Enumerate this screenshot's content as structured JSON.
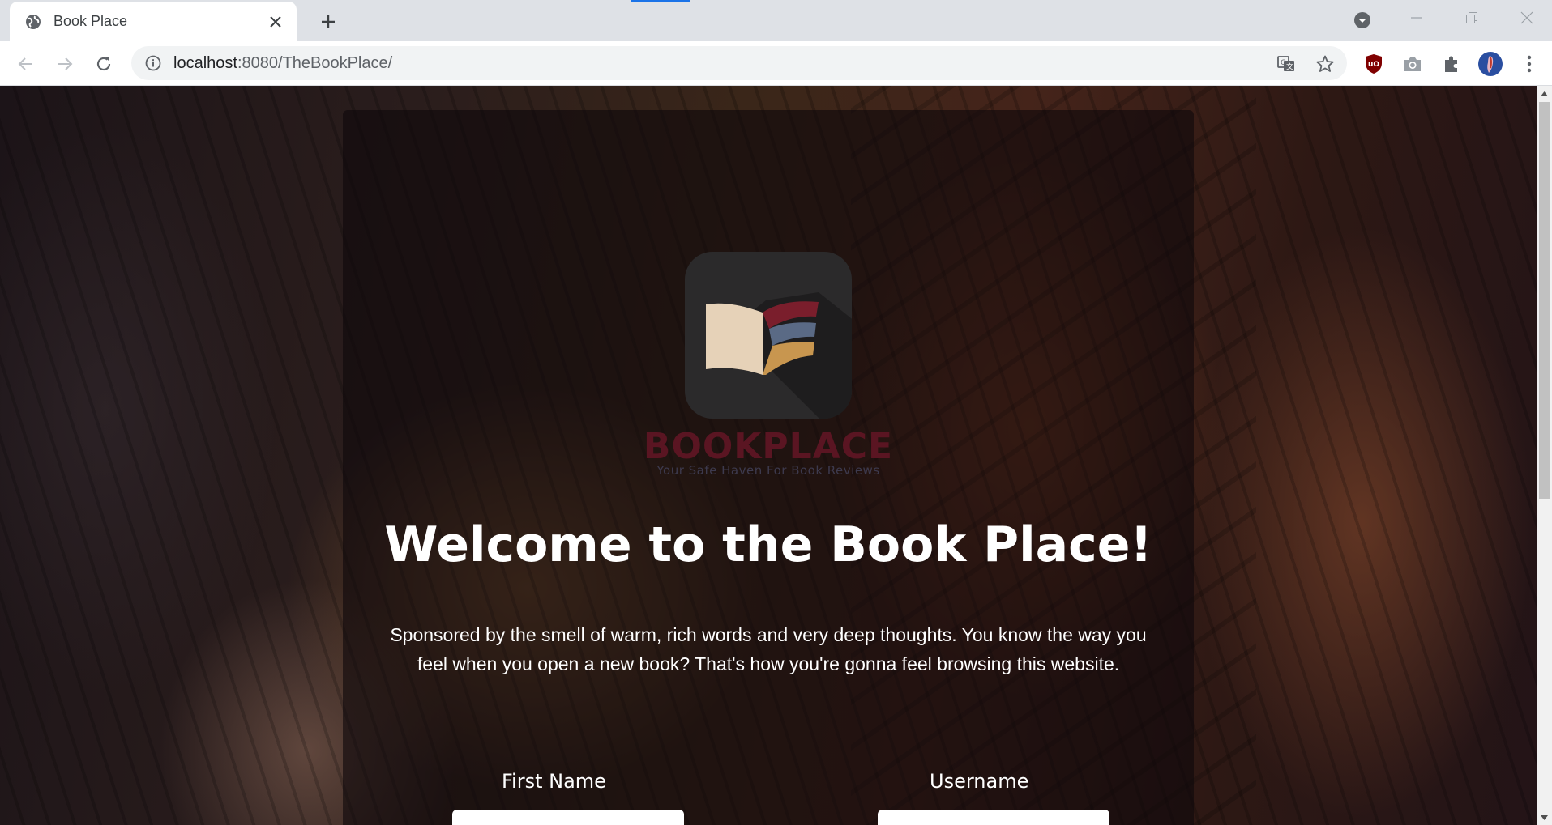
{
  "browser": {
    "tab": {
      "title": "Book Place",
      "favicon": "globe-icon",
      "close_icon": "close-icon"
    },
    "new_tab_icon": "plus-icon",
    "tab_search_icon": "chevron-down-icon",
    "window_controls": [
      "minimize-icon",
      "restore-icon",
      "close-icon"
    ],
    "nav": {
      "back": "arrow-left-icon",
      "forward": "arrow-right-icon",
      "reload": "reload-icon"
    },
    "omnibox": {
      "info_icon": "info-icon",
      "url_host": "localhost",
      "url_rest": ":8080/TheBookPlace/",
      "translate_icon": "translate-icon",
      "bookmark_icon": "star-icon"
    },
    "extensions": [
      "ublock-icon",
      "camera-icon",
      "puzzle-icon",
      "profile-avatar",
      "kebab-menu-icon"
    ],
    "colors": {
      "accent": "#1a73e8",
      "tabstrip": "#dee1e6"
    }
  },
  "page": {
    "logo": {
      "brand": "BOOKPLACE",
      "tagline": "Your Safe Haven For Book Reviews"
    },
    "heading": "Welcome to the Book Place!",
    "description_line1": "Sponsored by the smell of warm, rich words and very deep thoughts. You know the way you",
    "description_line2": "feel when you open a new book? That's how you're gonna feel browsing this website.",
    "form": {
      "first_name_label": "First Name",
      "first_name_value": "",
      "username_label": "Username",
      "username_value": ""
    },
    "colors": {
      "brand": "#5a1522",
      "logo_bg": "#2b2a2b",
      "book_cream": "#e6d2b8",
      "book_red": "#7a1e2c",
      "book_blue": "#5a6a85",
      "book_gold": "#c8964f"
    }
  }
}
